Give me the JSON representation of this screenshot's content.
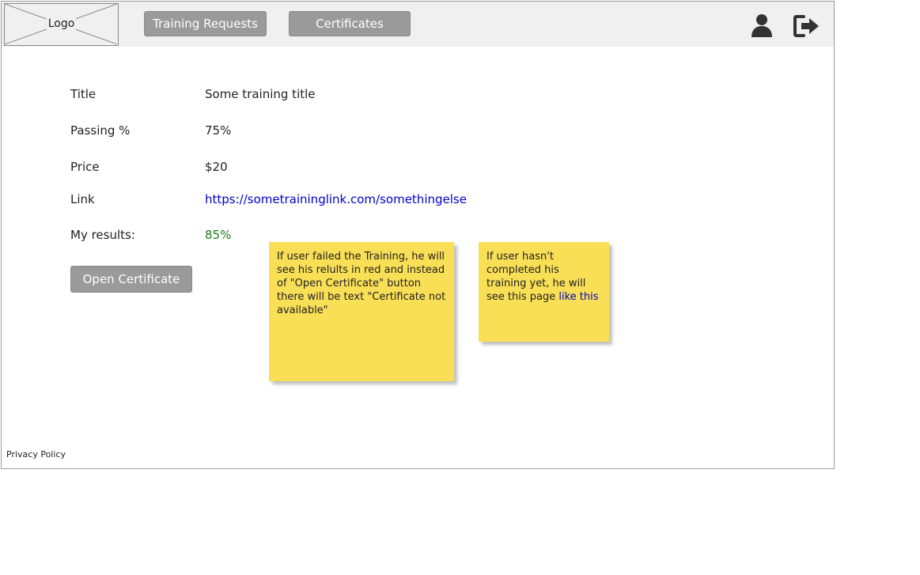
{
  "header": {
    "logo_label": "Logo",
    "nav": {
      "training_requests": "Training Requests",
      "certificates": "Certificates"
    },
    "icons": {
      "user": "user-icon",
      "logout": "logout-icon"
    }
  },
  "details": {
    "title_label": "Title",
    "title_value": "Some training title",
    "passing_label": "Passing %",
    "passing_value": "75%",
    "price_label": "Price",
    "price_value": "$20",
    "link_label": "Link",
    "link_value": "https://sometraininglink.com/somethingelse",
    "results_label": "My results:",
    "results_value": "85%"
  },
  "actions": {
    "open_certificate": "Open Certificate"
  },
  "notes": {
    "failed_note": "If user failed the Training, he will see his relults in red and instead of \"Open Certificate\" button there will be text \"Certificate not available\"",
    "incomplete_note_text": "If user hasn't completed his training yet, he will see this page ",
    "incomplete_note_link": "like this"
  },
  "footer": {
    "privacy_policy": "Privacy Policy"
  },
  "colors": {
    "header_bg": "#f0f0f0",
    "button_bg": "#9a9a9a",
    "link": "#0000cc",
    "result_pass": "#1e7a1e",
    "sticky_note": "#f8df56"
  }
}
